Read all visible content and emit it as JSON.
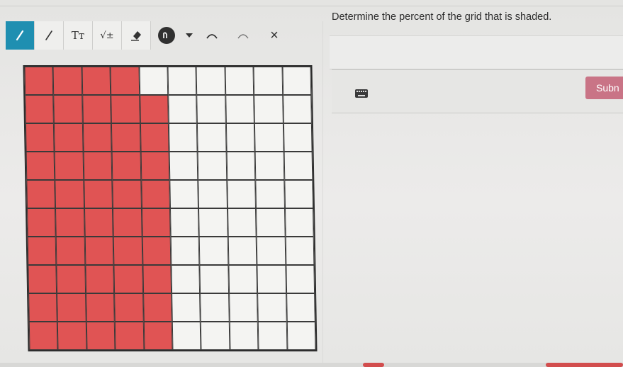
{
  "toolbar": {
    "tools": [
      {
        "name": "pencil-tool",
        "active": true
      },
      {
        "name": "line-tool",
        "active": false
      },
      {
        "name": "text-tool",
        "label": "Tт"
      },
      {
        "name": "math-tool",
        "label": "√±"
      },
      {
        "name": "eraser-tool"
      },
      {
        "name": "pen-color-tool"
      },
      {
        "name": "undo-tool"
      },
      {
        "name": "redo-tool"
      },
      {
        "name": "clear-tool",
        "label": "×"
      }
    ],
    "text_label": "Tт",
    "math_label": "√±",
    "clear_label": "×"
  },
  "question": {
    "prompt": "Determine the percent of the grid that is shaded."
  },
  "answer": {
    "submit_label": "Subn"
  },
  "grid": {
    "rows": 10,
    "cols": 10,
    "shaded_cells_per_row": [
      4,
      5,
      5,
      5,
      5,
      5,
      5,
      5,
      5,
      5
    ],
    "shaded_total": 49,
    "shade_color": "#e05454"
  },
  "colors": {
    "accent": "#1f8fb1",
    "submit": "#c97486"
  }
}
